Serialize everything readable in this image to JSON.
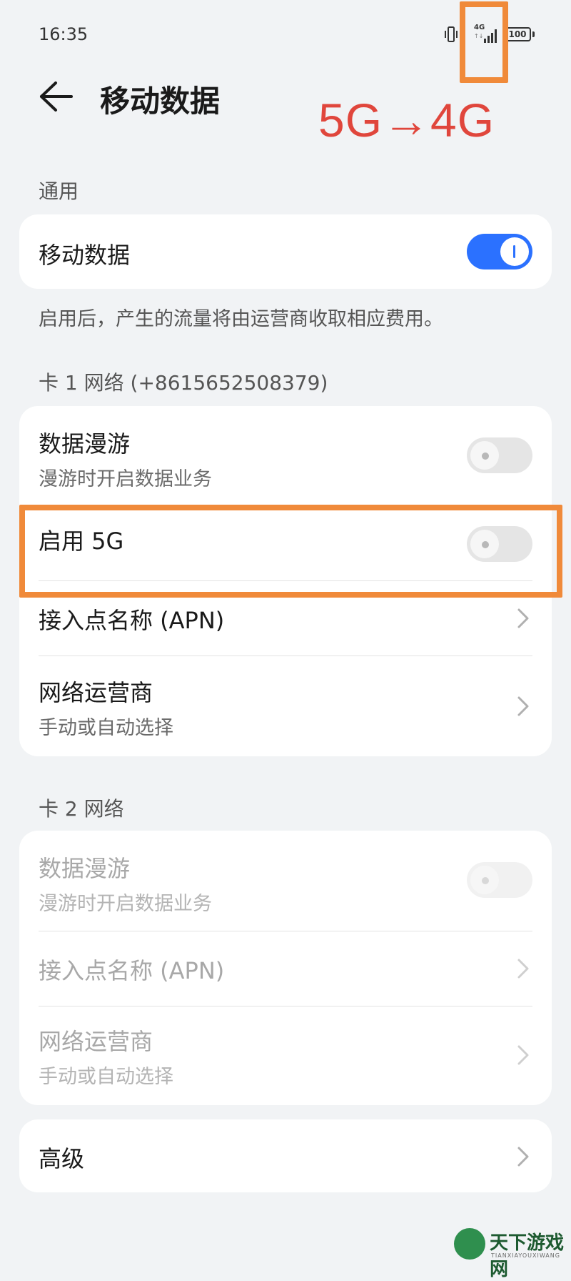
{
  "status_bar": {
    "time": "16:35",
    "network_type": "4G",
    "network_arrows": "↑↓",
    "battery": "100"
  },
  "header": {
    "back_icon": "arrow-left-icon",
    "title": "移动数据"
  },
  "annotation": {
    "text": "5G→4G",
    "color": "#e0463c",
    "highlight_color": "#f08a3a"
  },
  "general": {
    "section_label": "通用",
    "mobile_data": {
      "label": "移动数据",
      "enabled": true
    },
    "note": "启用后，产生的流量将由运营商收取相应费用。"
  },
  "sim1": {
    "section_label": "卡 1 网络 (+8615652508379)",
    "roaming": {
      "title": "数据漫游",
      "subtitle": "漫游时开启数据业务",
      "enabled": false
    },
    "enable_5g": {
      "title": "启用 5G",
      "enabled": false
    },
    "apn": {
      "title": "接入点名称 (APN)"
    },
    "carrier": {
      "title": "网络运营商",
      "subtitle": "手动或自动选择"
    }
  },
  "sim2": {
    "section_label": "卡 2 网络",
    "roaming": {
      "title": "数据漫游",
      "subtitle": "漫游时开启数据业务",
      "enabled": false
    },
    "apn": {
      "title": "接入点名称 (APN)"
    },
    "carrier": {
      "title": "网络运营商",
      "subtitle": "手动或自动选择"
    }
  },
  "advanced": {
    "title": "高级"
  },
  "watermark": {
    "text": "天下游戏网",
    "subtext": "TIANXIAYOUXIWANG"
  },
  "colors": {
    "accent": "#2b71ff",
    "background": "#f1f3f5"
  }
}
